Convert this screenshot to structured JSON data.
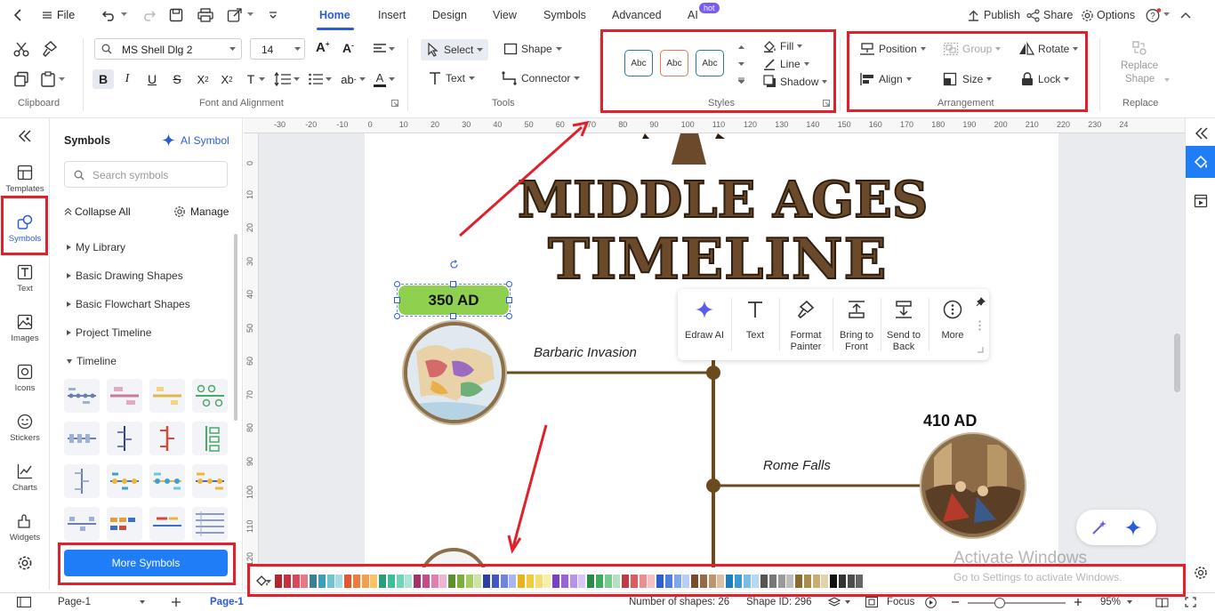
{
  "menu": {
    "file": "File",
    "tabs": [
      "Home",
      "Insert",
      "Design",
      "View",
      "Symbols",
      "Advanced",
      "AI"
    ],
    "active_tab": "Home",
    "ai_badge": "hot",
    "publish": "Publish",
    "share": "Share",
    "options": "Options"
  },
  "ribbon": {
    "font_name": "MS Shell Dlg 2",
    "font_size": "14",
    "select": "Select",
    "shape": "Shape",
    "text": "Text",
    "connector": "Connector",
    "styles_sample": "Abc",
    "fill": "Fill",
    "line": "Line",
    "shadow": "Shadow",
    "position": "Position",
    "group": "Group",
    "rotate": "Rotate",
    "align": "Align",
    "size": "Size",
    "lock": "Lock",
    "replace_shape_1": "Replace",
    "replace_shape_2": "Shape",
    "groups": {
      "clipboard": "Clipboard",
      "font": "Font and Alignment",
      "tools": "Tools",
      "styles": "Styles",
      "arrangement": "Arrangement",
      "replace": "Replace"
    }
  },
  "leftbar": {
    "items": [
      "Templates",
      "Symbols",
      "Text",
      "Images",
      "Icons",
      "Stickers",
      "Charts",
      "Widgets"
    ]
  },
  "panel": {
    "title": "Symbols",
    "ai_symbol": "AI Symbol",
    "search_placeholder": "Search symbols",
    "collapse_all": "Collapse All",
    "manage": "Manage",
    "tree": [
      "My Library",
      "Basic Drawing Shapes",
      "Basic Flowchart Shapes",
      "Project Timeline",
      "Timeline"
    ],
    "more_symbols": "More Symbols"
  },
  "ruler": {
    "top": [
      "-30",
      "-20",
      "-10",
      "0",
      "10",
      "20",
      "30",
      "40",
      "50",
      "60",
      "70",
      "80",
      "90",
      "100",
      "110",
      "120",
      "130",
      "140",
      "150",
      "160",
      "170",
      "180",
      "190",
      "200",
      "210",
      "220",
      "230",
      "24"
    ],
    "left": [
      "0",
      "10",
      "20",
      "30",
      "40",
      "50",
      "60",
      "70",
      "80",
      "90",
      "100",
      "110",
      "120"
    ]
  },
  "canvas": {
    "title_line1": "MIDDLE AGES",
    "title_line2": "TIMELINE",
    "label_350": "350 AD",
    "label_410": "410 AD",
    "event1": "Barbaric Invasion",
    "event2": "Rome Falls"
  },
  "floating_toolbar": {
    "items": [
      {
        "l1": "Edraw AI",
        "l2": ""
      },
      {
        "l1": "Text",
        "l2": ""
      },
      {
        "l1": "Format",
        "l2": "Painter"
      },
      {
        "l1": "Bring to",
        "l2": "Front"
      },
      {
        "l1": "Send to",
        "l2": "Back"
      },
      {
        "l1": "More",
        "l2": ""
      }
    ]
  },
  "watermark": {
    "line1": "Activate Windows",
    "line2": "Go to Settings to activate Windows."
  },
  "palette_colors": [
    "#b3242c",
    "#c7303d",
    "#d8485a",
    "#e57a86",
    "#3d7f8c",
    "#3aa0b4",
    "#6cc4d4",
    "#a5dce6",
    "#e8542c",
    "#f07a3c",
    "#f4a04a",
    "#f7c46b",
    "#2a9d7a",
    "#3cbf98",
    "#6fd5b8",
    "#a8e6d5",
    "#a7306b",
    "#c74a8a",
    "#e07fb0",
    "#efb4d2",
    "#5f8f2c",
    "#7cae3c",
    "#a6cc64",
    "#cde3a1",
    "#2c3fa8",
    "#4157c9",
    "#6f84e0",
    "#a8b5ef",
    "#e9b21f",
    "#f3cb3a",
    "#f7dd6f",
    "#fbeca6",
    "#7d3fc9",
    "#9a61dc",
    "#bb92ea",
    "#dac6f4",
    "#2a8a48",
    "#3aae5c",
    "#74cc8c",
    "#b0e3bd",
    "#c2393f",
    "#dd5a5e",
    "#ec8d8f",
    "#f5c0c1",
    "#2f5fc8",
    "#4c7fe0",
    "#81a6ee",
    "#b8cdf6",
    "#7a4a2a",
    "#9a6a44",
    "#c0946c",
    "#ddc0a3",
    "#1e7fbf",
    "#3a9ad6",
    "#78bde6",
    "#b3daf2",
    "#555555",
    "#777777",
    "#9a9a9a",
    "#bdbdbd",
    "#8a6d2e",
    "#ad8c4a",
    "#c9ad75",
    "#e2d3ad",
    "#111111",
    "#333333",
    "#4d4d4d",
    "#666666"
  ],
  "status": {
    "page_tab": "Page-1",
    "page_active": "Page-1",
    "num_shapes": "Number of shapes: 26",
    "shape_id": "Shape ID: 296",
    "focus": "Focus",
    "zoom": "95%"
  },
  "colors": {
    "accent": "#2b5bd7",
    "annotation_red": "#e0202a",
    "more_symbols_bg": "#1f7ef7",
    "shape_green": "#8fd14f",
    "timeline_brown": "#6b4a1e"
  }
}
